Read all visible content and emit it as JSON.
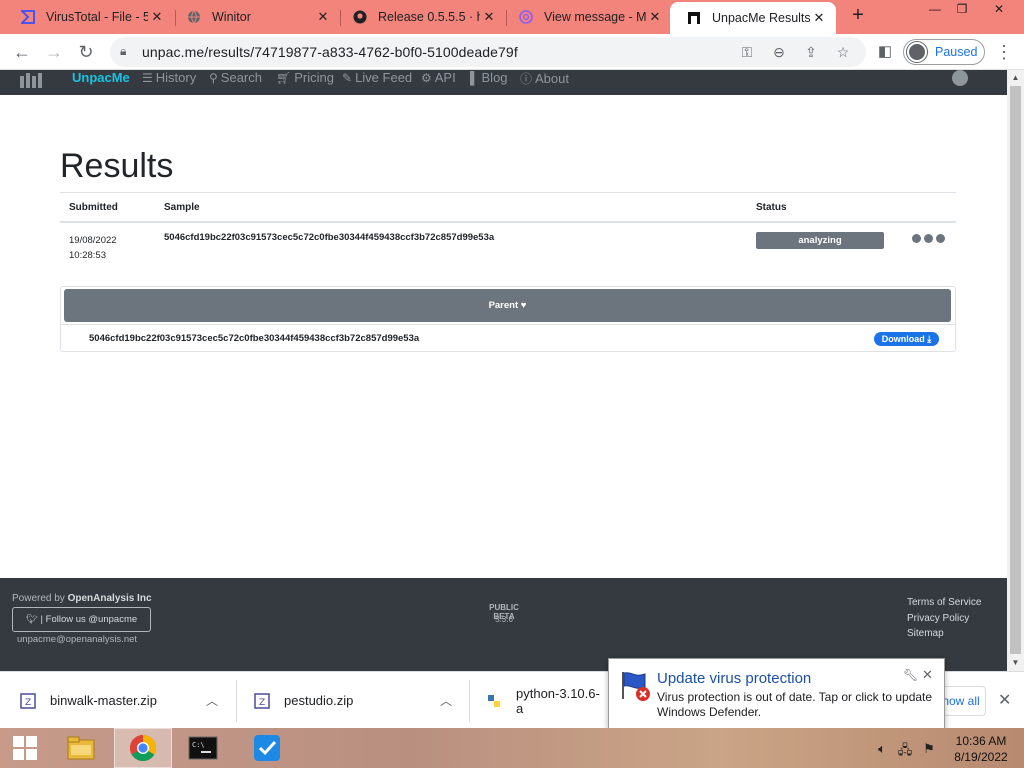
{
  "browser": {
    "tabs": [
      {
        "title": "VirusTotal - File - 5",
        "icon": "virustotal-icon"
      },
      {
        "title": "Winitor",
        "icon": "globe-icon"
      },
      {
        "title": "Release 0.5.5.5 · ha",
        "icon": "github-icon"
      },
      {
        "title": "View message - M",
        "icon": "mail-icon"
      },
      {
        "title": "UnpacMe Results",
        "icon": "unpacme-icon"
      }
    ],
    "new_tab": "+",
    "url": "unpac.me/results/74719877-a833-4762-b0f0-5100deade79f",
    "profile_label": "Paused"
  },
  "site_nav": {
    "brand": "UnpacMe",
    "links": [
      "History",
      "Search",
      "Pricing",
      "Live Feed",
      "API",
      "Blog",
      "About"
    ]
  },
  "results": {
    "heading": "Results",
    "columns": {
      "submitted": "Submitted",
      "sample": "Sample",
      "status": "Status"
    },
    "row": {
      "date": "19/08/2022",
      "time": "10:28:53",
      "sample": "5046cfd19bc22f03c91573cec5c72c0fbe30344f459438ccf3b72c857d99e53a",
      "status": "analyzing"
    },
    "parent_label": "Parent",
    "child_hash": "5046cfd19bc22f03c91573cec5c72c0fbe30344f459438ccf3b72c857d99e53a",
    "download_label": "Download"
  },
  "footer": {
    "powered_prefix": "Powered by",
    "powered_company": "OpenAnalysis Inc",
    "follow": "| Follow us @unpacme",
    "email": "unpacme@openanalysis.net",
    "beta": "PUBLIC BETA",
    "version": "5.3.6",
    "links": [
      "Terms of Service",
      "Privacy Policy",
      "Sitemap"
    ]
  },
  "downloads": {
    "items": [
      "binwalk-master.zip",
      "pestudio.zip",
      "python-3.10.6-a"
    ],
    "show_all": "Show all"
  },
  "toast": {
    "title": "Update virus protection",
    "message": "Virus protection is out of date. Tap or click to update Windows Defender."
  },
  "taskbar": {
    "time": "10:36 AM",
    "date": "8/19/2022"
  },
  "colors": {
    "tabstrip": "#f2847c",
    "navbar": "#343a40",
    "brand": "#19c2e0",
    "badge": "#6c757d",
    "download_button": "#1a73e8"
  }
}
